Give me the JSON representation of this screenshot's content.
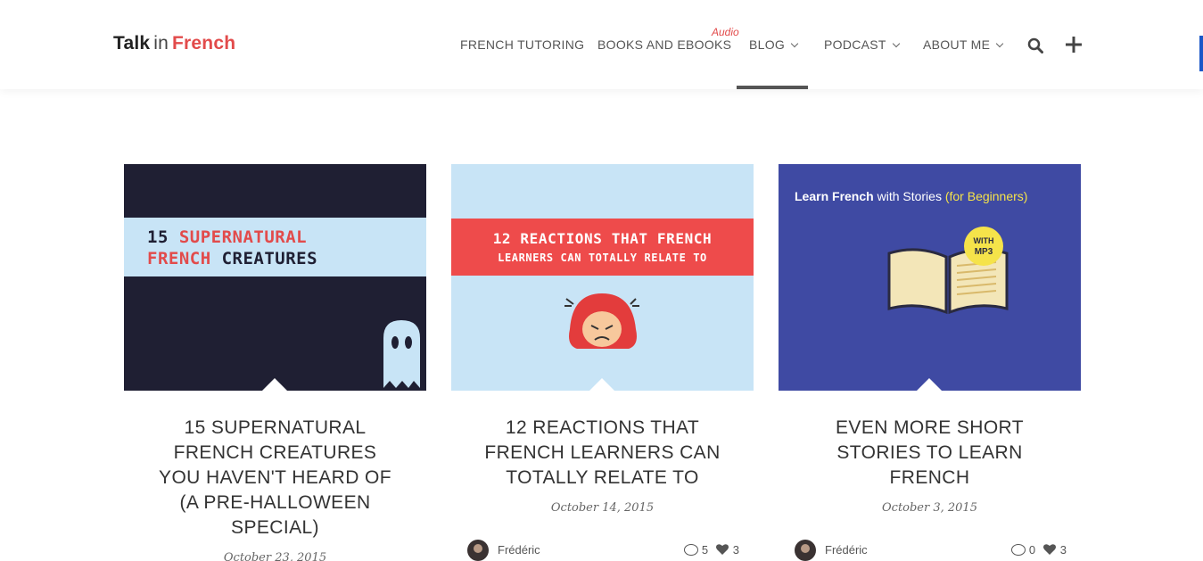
{
  "brand": {
    "logo_talk": "Talk",
    "logo_in": "in",
    "logo_french": "French"
  },
  "nav": {
    "items": [
      {
        "label": "FRENCH TUTORING",
        "dropdown": false
      },
      {
        "label": "BOOKS AND EBOOKS",
        "dropdown": false
      },
      {
        "label": "BLOG",
        "dropdown": true,
        "active": true
      },
      {
        "label": "PODCAST",
        "dropdown": true
      },
      {
        "label": "ABOUT ME",
        "dropdown": true
      }
    ],
    "books_badge": "Audio",
    "search_icon": "search-icon",
    "plus_icon": "plus-icon"
  },
  "colors": {
    "accent": "#e24b4b",
    "edge": "#1a57c8",
    "card3_bg": "#3f4aa3"
  },
  "posts": [
    {
      "thumb_line1_a": "15 ",
      "thumb_line1_b": "SUPERNATURAL",
      "thumb_line2_a": "FRENCH",
      "thumb_line2_b": " CREATURES",
      "title": "15 SUPERNATURAL FRENCH CREATURES YOU HAVEN'T HEARD OF (A PRE-HALLOWEEN SPECIAL)",
      "date": "October 23, 2015"
    },
    {
      "thumb_line1": "12 REACTIONS THAT FRENCH",
      "thumb_line2": "LEARNERS CAN TOTALLY RELATE TO",
      "title": "12 REACTIONS THAT FRENCH LEARNERS CAN TOTALLY RELATE TO",
      "date": "October 14, 2015",
      "author": "Frédéric",
      "comments": "5",
      "likes": "3"
    },
    {
      "thumb_a": "Learn French",
      "thumb_b": " with Stories ",
      "thumb_c": "(for Beginners)",
      "thumb_badge_1": "WITH",
      "thumb_badge_2": "MP3",
      "title": "EVEN MORE SHORT STORIES TO LEARN FRENCH",
      "date": "October 3, 2015",
      "author": "Frédéric",
      "comments": "0",
      "likes": "3"
    }
  ]
}
